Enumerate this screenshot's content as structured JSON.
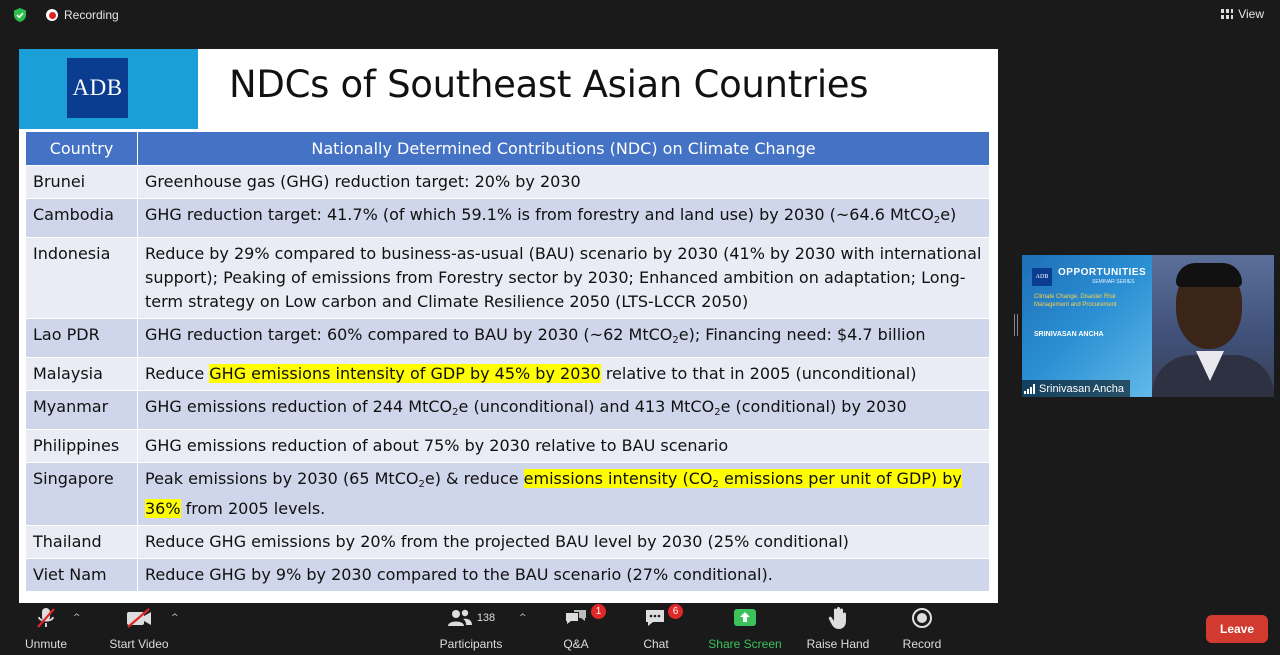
{
  "topbar": {
    "recording_label": "Recording",
    "view_label": "View"
  },
  "slide": {
    "logo_text": "ADB",
    "title": "NDCs of Southeast Asian Countries",
    "headers": [
      "Country",
      "Nationally Determined Contributions (NDC) on Climate Change"
    ],
    "rows": [
      {
        "country": "Brunei",
        "ndc": "Greenhouse gas (GHG) reduction target: 20% by 2030"
      },
      {
        "country": "Cambodia",
        "ndc_parts": [
          "GHG reduction target: 41.7% (of which 59.1% is from forestry and land use) by 2030 (~64.6 MtCO",
          "2",
          "e)"
        ]
      },
      {
        "country": "Indonesia",
        "ndc": "Reduce by 29% compared to business-as-usual (BAU) scenario by 2030 (41% by 2030 with international support); Peaking of emissions from Forestry sector by 2030; Enhanced ambition on adaptation; Long-term strategy on Low carbon and Climate Resilience 2050 (LTS-LCCR 2050)"
      },
      {
        "country": "Lao PDR",
        "ndc_parts": [
          "GHG reduction target: 60% compared to BAU by 2030 (~62 MtCO",
          "2",
          "e); Financing need: $4.7 billion"
        ]
      },
      {
        "country": "Malaysia",
        "ndc_parts": [
          "Reduce ",
          "GHG emissions intensity of GDP by 45% by 2030",
          " relative to that in 2005 (unconditional)"
        ]
      },
      {
        "country": "Myanmar",
        "ndc_parts": [
          "GHG emissions reduction of 244 MtCO",
          "2",
          "e (unconditional) and 413 MtCO",
          "2",
          "e (conditional) by 2030"
        ]
      },
      {
        "country": "Philippines",
        "ndc": "GHG emissions reduction of about 75% by 2030 relative to BAU scenario"
      },
      {
        "country": "Singapore",
        "ndc_parts": [
          "Peak emissions by 2030 (65 MtCO",
          "2",
          "e) & reduce ",
          "emissions intensity (CO",
          "2",
          " emissions per unit of GDP) by 36%",
          " from 2005 levels."
        ]
      },
      {
        "country": "Thailand",
        "ndc": "Reduce GHG emissions by 20% from the projected BAU level by 2030 (25% conditional)"
      },
      {
        "country": "Viet Nam",
        "ndc": "Reduce GHG by 9% by 2030 compared to the BAU scenario (27% conditional)."
      }
    ]
  },
  "video_tile": {
    "participant_name": "Srinivasan Ancha",
    "banner_logo": "ADB",
    "banner_title": "OPPORTUNITIES",
    "banner_series": "SEMINAR SERIES",
    "banner_topic": "Climate Change, Disaster Risk Management and Procurement",
    "banner_speaker": "SRINIVASAN ANCHA"
  },
  "toolbar": {
    "unmute": "Unmute",
    "start_video": "Start Video",
    "participants": "Participants",
    "participants_count": "138",
    "qa": "Q&A",
    "qa_badge": "1",
    "chat": "Chat",
    "chat_badge": "6",
    "share_screen": "Share Screen",
    "raise_hand": "Raise Hand",
    "record": "Record",
    "leave": "Leave"
  },
  "colors": {
    "table_header": "#4472c4",
    "row_odd": "#cfd5ea",
    "row_even": "#e9ebf5",
    "highlight": "#ffff00",
    "adb_blue": "#1a9fd9",
    "share_green": "#3cc15b",
    "leave_red": "#d23a2f"
  }
}
